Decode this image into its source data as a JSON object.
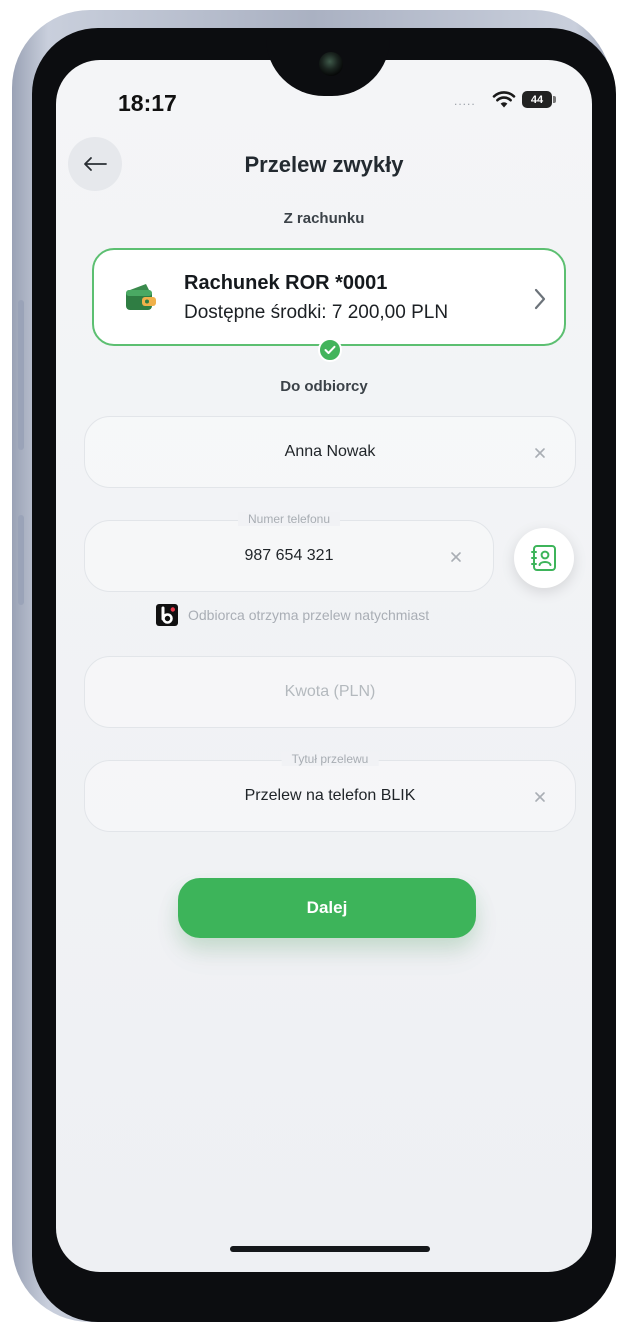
{
  "status_bar": {
    "time": "18:17",
    "signal": ".....",
    "battery": "44"
  },
  "header": {
    "title": "Przelew zwykły"
  },
  "from_section": {
    "label": "Z rachunku"
  },
  "account": {
    "name": "Rachunek ROR *0001",
    "balance": "Dostępne środki: 7 200,00 PLN"
  },
  "to_section": {
    "label": "Do odbiorcy"
  },
  "recipient": {
    "value": "Anna Nowak"
  },
  "phone": {
    "label": "Numer telefonu",
    "value": "987 654 321"
  },
  "blik_note": {
    "text": "Odbiorca otrzyma przelew natychmiast"
  },
  "amount": {
    "placeholder": "Kwota (PLN)"
  },
  "title_field": {
    "label": "Tytuł przelewu",
    "value": "Przelew na telefon BLIK"
  },
  "actions": {
    "next_label": "Dalej"
  },
  "colors": {
    "accent": "#3db45a",
    "card_border": "#5cbf71"
  }
}
